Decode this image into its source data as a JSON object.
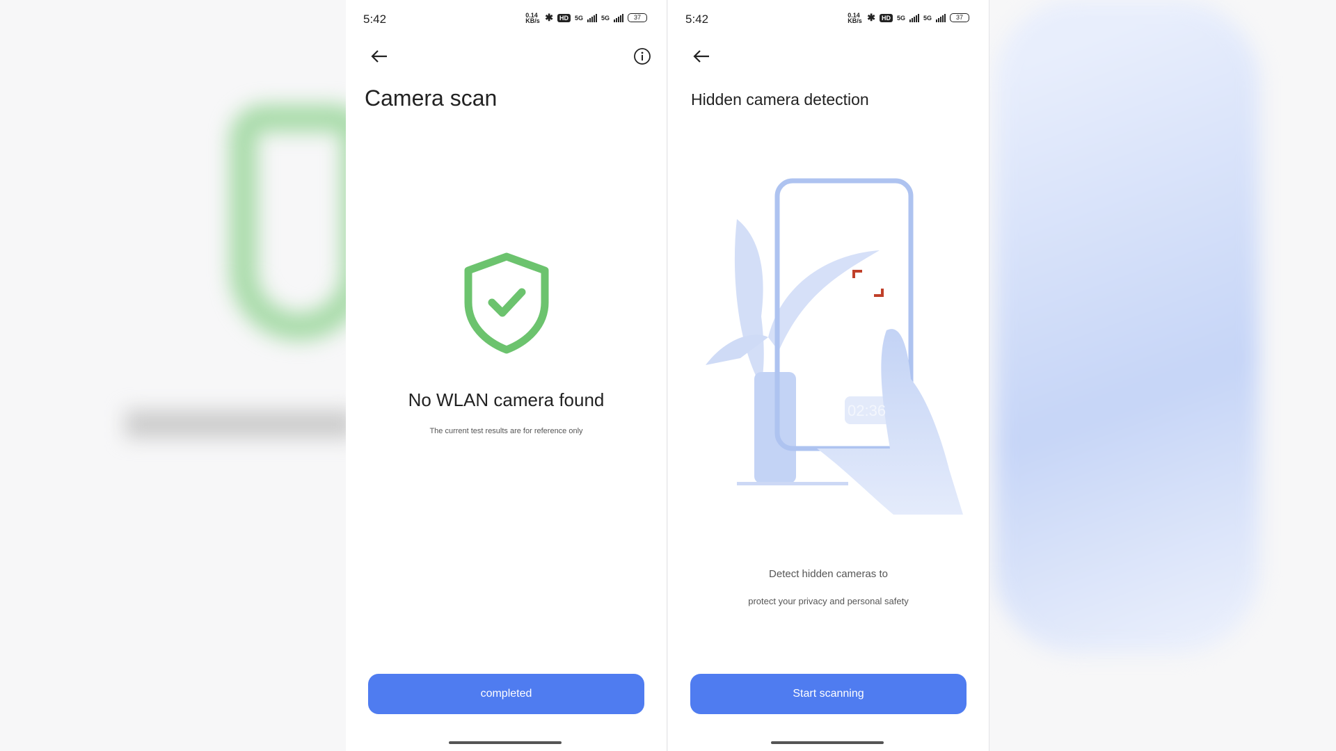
{
  "status_bar": {
    "time": "5:42",
    "speed": "0.14 KB/s",
    "hd": "HD",
    "network1": "5G",
    "network2": "5G",
    "battery": "37"
  },
  "left_screen": {
    "title": "Camera scan",
    "result": "No WLAN camera found",
    "note": "The current test results are for reference only",
    "button": "completed",
    "shield_color": "#6cc36e"
  },
  "right_screen": {
    "title": "Hidden camera detection",
    "illustration_timer": "02:36",
    "description_line1": "Detect hidden cameras to",
    "description_line2": "protect your privacy and personal safety",
    "button": "Start scanning"
  },
  "colors": {
    "accent": "#4f7cf0",
    "illustration": "#a9c0f2",
    "focus_corner": "#c0402a"
  }
}
